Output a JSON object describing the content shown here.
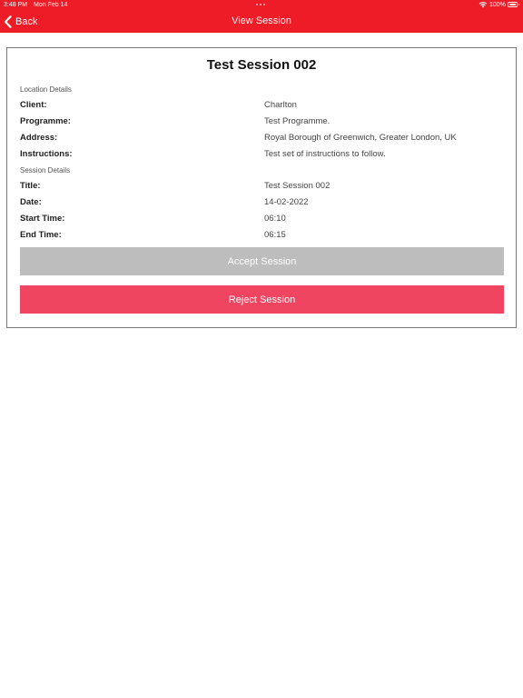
{
  "status_bar": {
    "time": "3:48 PM",
    "date": "Mon Feb 14",
    "battery": "100%"
  },
  "nav": {
    "back_label": "Back",
    "title": "View Session"
  },
  "session": {
    "title": "Test Session 002",
    "location_section": "Location Details",
    "session_section": "Session Details",
    "location_rows": [
      {
        "label": "Client:",
        "value": "Charlton"
      },
      {
        "label": "Programme:",
        "value": "Test Programme."
      },
      {
        "label": "Address:",
        "value": "Royal Borough of Greenwich, Greater London, UK"
      },
      {
        "label": "Instructions:",
        "value": "Test set of instructions to follow."
      }
    ],
    "session_rows": [
      {
        "label": "Title:",
        "value": "Test Session 002"
      },
      {
        "label": "Date:",
        "value": "14-02-2022"
      },
      {
        "label": "Start Time:",
        "value": "06:10"
      },
      {
        "label": "End Time:",
        "value": "06:15"
      }
    ]
  },
  "actions": {
    "accept_label": "Accept Session",
    "reject_label": "Reject Session"
  },
  "colors": {
    "header": "#ee1c27",
    "accept_disabled": "#bdbdbd",
    "reject": "#ef4560"
  }
}
